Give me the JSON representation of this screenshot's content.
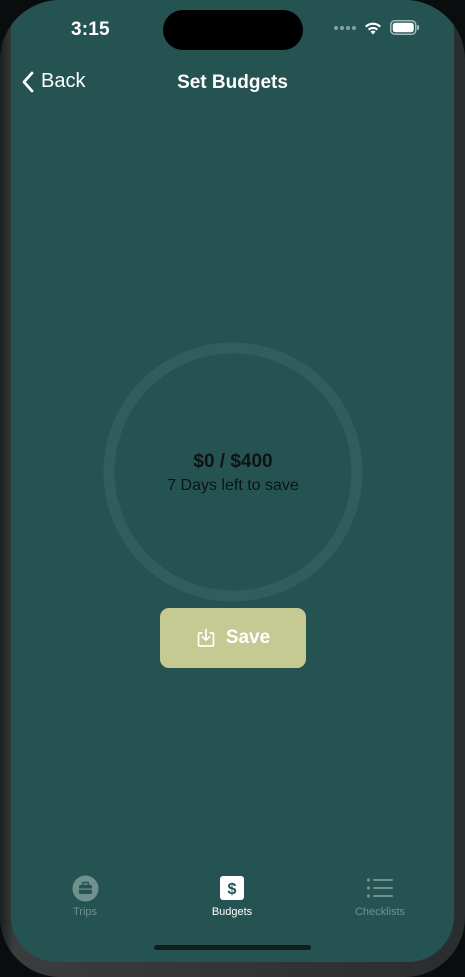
{
  "status_bar": {
    "time": "3:15"
  },
  "navbar": {
    "back_label": "Back",
    "title": "Set Budgets"
  },
  "budget": {
    "amount_text": "$0 / $400",
    "days_text": "7 Days left to save",
    "progress_fraction": 0
  },
  "save_button": {
    "label": "Save",
    "icon": "download-tray-icon"
  },
  "tabs": [
    {
      "label": "Trips",
      "icon": "briefcase-icon",
      "active": false
    },
    {
      "label": "Budgets",
      "icon": "dollar-sign-icon",
      "active": true
    },
    {
      "label": "Checklists",
      "icon": "list-icon",
      "active": false
    }
  ],
  "colors": {
    "background": "#255352",
    "ring": "#2f5e5d",
    "save_button": "#c5ca93",
    "tab_inactive": "#70908e",
    "tab_active": "#ffffff"
  }
}
